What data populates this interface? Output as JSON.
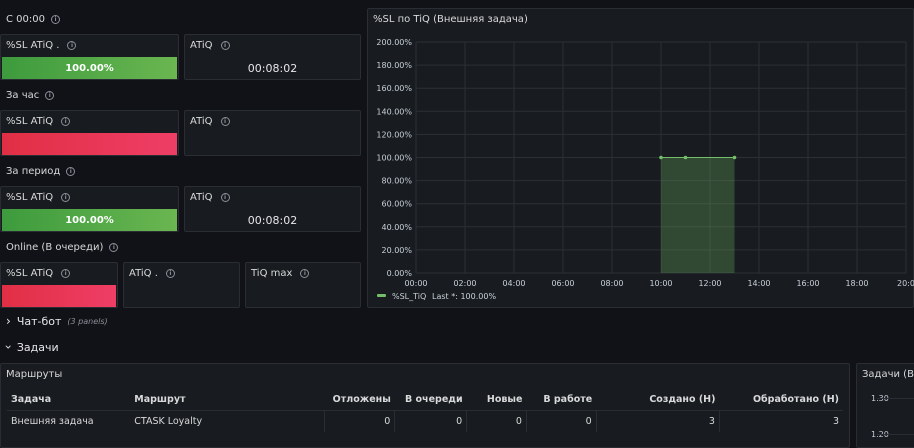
{
  "colors": {
    "bg": "#111217",
    "panel": "#181b1f",
    "green": "#56a64b",
    "red": "#e02f44",
    "series": "#73bf69"
  },
  "groups": [
    {
      "title": "С 00:00",
      "sl_title": "%SL ATiQ .",
      "sl_value": "100.00%",
      "sl_state": "green",
      "atiq_title": "ATiQ",
      "atiq_value": "00:08:02"
    },
    {
      "title": "За час",
      "sl_title": "%SL ATiQ",
      "sl_value": "",
      "sl_state": "red",
      "atiq_title": "ATiQ",
      "atiq_value": ""
    },
    {
      "title": "За период",
      "sl_title": "%SL ATiQ",
      "sl_value": "100.00%",
      "sl_state": "green",
      "atiq_title": "ATiQ",
      "atiq_value": "00:08:02"
    }
  ],
  "online": {
    "title": "Online (В очереди)",
    "sl_title": "%SL ATiQ",
    "atiq_title": "ATiQ .",
    "tiq_title": "TiQ max"
  },
  "chart_panel": {
    "title": "%SL по TiQ (Внешняя задача)"
  },
  "chart_data": {
    "type": "area",
    "title": "%SL по TiQ (Внешняя задача)",
    "x_ticks": [
      "00:00",
      "02:00",
      "04:00",
      "06:00",
      "08:00",
      "10:00",
      "12:00",
      "14:00",
      "16:00",
      "18:00",
      "20:0"
    ],
    "y_ticks": [
      "0.00%",
      "20.00%",
      "40.00%",
      "60.00%",
      "80.00%",
      "100.00%",
      "120.00%",
      "140.00%",
      "160.00%",
      "180.00%",
      "200.00%"
    ],
    "ylim": [
      0,
      200
    ],
    "xlim_hours": [
      0,
      20
    ],
    "series": [
      {
        "name": "%SL_TiQ",
        "x_hours": [
          10,
          11,
          13
        ],
        "values": [
          100,
          100,
          100
        ]
      }
    ],
    "legend": {
      "label": "%SL_TiQ",
      "last_text": "Last *: 100.00%",
      "placement": "bottom-left"
    },
    "grid": true
  },
  "chatbot": {
    "title": "Чат-бот",
    "sub": "(3 panels)",
    "chevron": "›"
  },
  "tasks": {
    "title": "Задачи",
    "chevron": "›"
  },
  "routes": {
    "title": "Маршруты",
    "columns": [
      "Задача",
      "Маршрут",
      "Отложены",
      "В очереди",
      "Новые",
      "В работе",
      "Создано (Н)",
      "Обработано (Н)"
    ],
    "rows": [
      [
        "Внешняя задача",
        "CTASK Loyalty",
        "0",
        "0",
        "0",
        "0",
        "3",
        "3"
      ]
    ]
  },
  "right_panel": {
    "title": "Задачи (Вне",
    "y1": "1.30",
    "y2": "1.20"
  }
}
